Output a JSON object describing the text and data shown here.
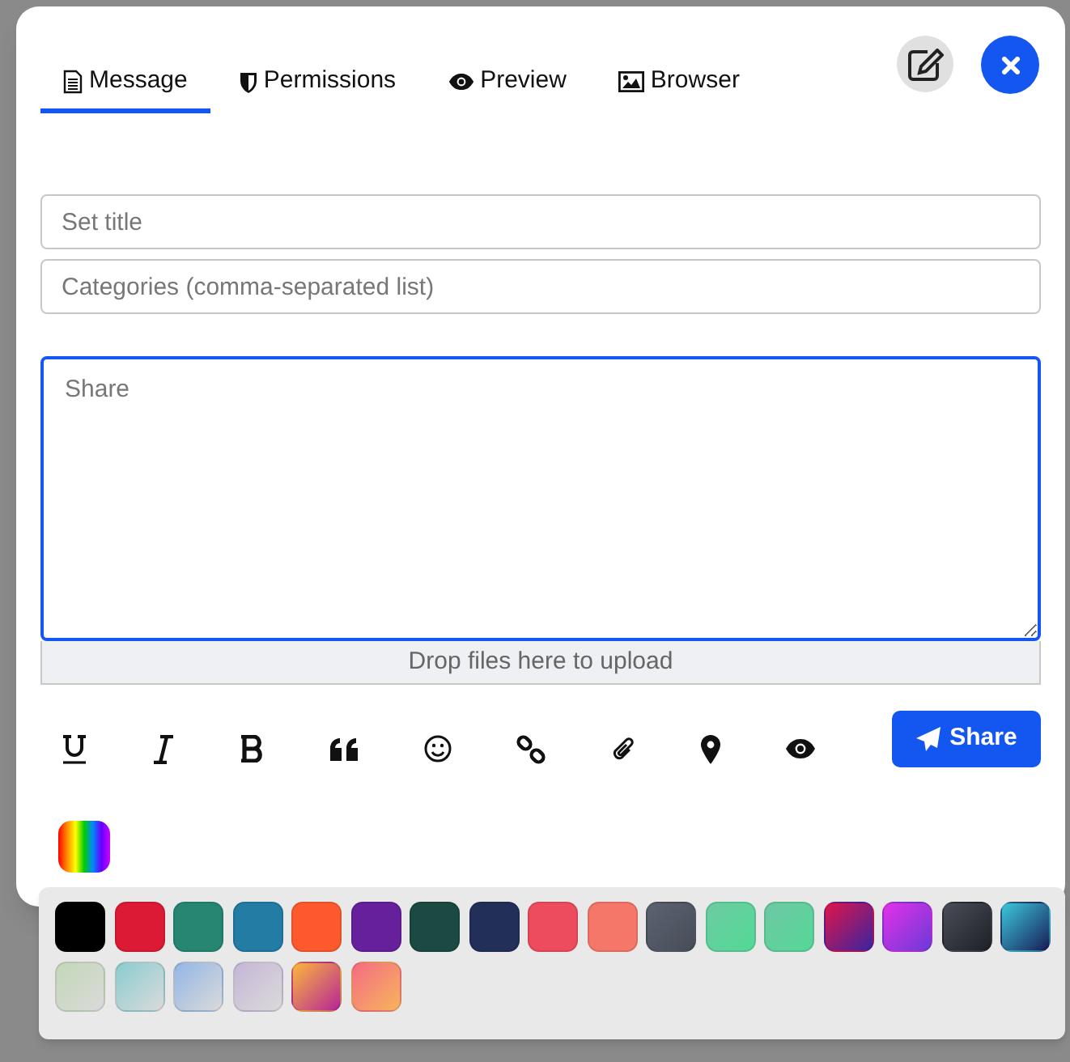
{
  "tabs": [
    {
      "label": "Message",
      "selected": true
    },
    {
      "label": "Permissions",
      "selected": false
    },
    {
      "label": "Preview",
      "selected": false
    },
    {
      "label": "Browser",
      "selected": false
    }
  ],
  "title_field": {
    "placeholder": "Set title"
  },
  "categories_field": {
    "placeholder": "Categories (comma-separated list)"
  },
  "message_field": {
    "placeholder": "Share"
  },
  "drop_zone": "Drop files here to upload",
  "share_button": "Share",
  "swatches": [
    {
      "kind": "solid",
      "color": "#000000"
    },
    {
      "kind": "solid",
      "color": "#dc1a36"
    },
    {
      "kind": "solid",
      "color": "#268672"
    },
    {
      "kind": "solid",
      "color": "#227ca4"
    },
    {
      "kind": "solid",
      "color": "#fc5a2c"
    },
    {
      "kind": "solid",
      "color": "#66209c"
    },
    {
      "kind": "solid",
      "color": "#1a4a42"
    },
    {
      "kind": "solid",
      "color": "#222f58"
    },
    {
      "kind": "solid",
      "color": "#ec4c5e"
    },
    {
      "kind": "solid",
      "color": "#f4776a"
    },
    {
      "kind": "gradient"
    },
    {
      "kind": "gradient"
    },
    {
      "kind": "gradient"
    },
    {
      "kind": "gradient"
    },
    {
      "kind": "gradient"
    },
    {
      "kind": "gradient"
    },
    {
      "kind": "gradient"
    },
    {
      "kind": "gradient"
    },
    {
      "kind": "gradient"
    },
    {
      "kind": "gradient"
    },
    {
      "kind": "gradient"
    },
    {
      "kind": "gradient"
    },
    {
      "kind": "gradient"
    }
  ]
}
